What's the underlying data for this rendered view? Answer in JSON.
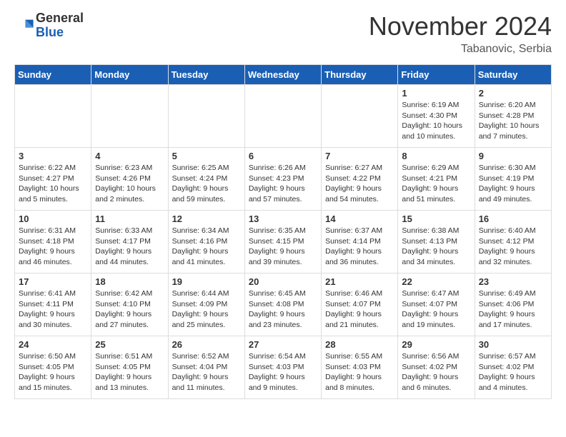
{
  "header": {
    "logo_general": "General",
    "logo_blue": "Blue",
    "month_title": "November 2024",
    "location": "Tabanovic, Serbia"
  },
  "weekdays": [
    "Sunday",
    "Monday",
    "Tuesday",
    "Wednesday",
    "Thursday",
    "Friday",
    "Saturday"
  ],
  "weeks": [
    [
      {
        "day": "",
        "info": ""
      },
      {
        "day": "",
        "info": ""
      },
      {
        "day": "",
        "info": ""
      },
      {
        "day": "",
        "info": ""
      },
      {
        "day": "",
        "info": ""
      },
      {
        "day": "1",
        "info": "Sunrise: 6:19 AM\nSunset: 4:30 PM\nDaylight: 10 hours and 10 minutes."
      },
      {
        "day": "2",
        "info": "Sunrise: 6:20 AM\nSunset: 4:28 PM\nDaylight: 10 hours and 7 minutes."
      }
    ],
    [
      {
        "day": "3",
        "info": "Sunrise: 6:22 AM\nSunset: 4:27 PM\nDaylight: 10 hours and 5 minutes."
      },
      {
        "day": "4",
        "info": "Sunrise: 6:23 AM\nSunset: 4:26 PM\nDaylight: 10 hours and 2 minutes."
      },
      {
        "day": "5",
        "info": "Sunrise: 6:25 AM\nSunset: 4:24 PM\nDaylight: 9 hours and 59 minutes."
      },
      {
        "day": "6",
        "info": "Sunrise: 6:26 AM\nSunset: 4:23 PM\nDaylight: 9 hours and 57 minutes."
      },
      {
        "day": "7",
        "info": "Sunrise: 6:27 AM\nSunset: 4:22 PM\nDaylight: 9 hours and 54 minutes."
      },
      {
        "day": "8",
        "info": "Sunrise: 6:29 AM\nSunset: 4:21 PM\nDaylight: 9 hours and 51 minutes."
      },
      {
        "day": "9",
        "info": "Sunrise: 6:30 AM\nSunset: 4:19 PM\nDaylight: 9 hours and 49 minutes."
      }
    ],
    [
      {
        "day": "10",
        "info": "Sunrise: 6:31 AM\nSunset: 4:18 PM\nDaylight: 9 hours and 46 minutes."
      },
      {
        "day": "11",
        "info": "Sunrise: 6:33 AM\nSunset: 4:17 PM\nDaylight: 9 hours and 44 minutes."
      },
      {
        "day": "12",
        "info": "Sunrise: 6:34 AM\nSunset: 4:16 PM\nDaylight: 9 hours and 41 minutes."
      },
      {
        "day": "13",
        "info": "Sunrise: 6:35 AM\nSunset: 4:15 PM\nDaylight: 9 hours and 39 minutes."
      },
      {
        "day": "14",
        "info": "Sunrise: 6:37 AM\nSunset: 4:14 PM\nDaylight: 9 hours and 36 minutes."
      },
      {
        "day": "15",
        "info": "Sunrise: 6:38 AM\nSunset: 4:13 PM\nDaylight: 9 hours and 34 minutes."
      },
      {
        "day": "16",
        "info": "Sunrise: 6:40 AM\nSunset: 4:12 PM\nDaylight: 9 hours and 32 minutes."
      }
    ],
    [
      {
        "day": "17",
        "info": "Sunrise: 6:41 AM\nSunset: 4:11 PM\nDaylight: 9 hours and 30 minutes."
      },
      {
        "day": "18",
        "info": "Sunrise: 6:42 AM\nSunset: 4:10 PM\nDaylight: 9 hours and 27 minutes."
      },
      {
        "day": "19",
        "info": "Sunrise: 6:44 AM\nSunset: 4:09 PM\nDaylight: 9 hours and 25 minutes."
      },
      {
        "day": "20",
        "info": "Sunrise: 6:45 AM\nSunset: 4:08 PM\nDaylight: 9 hours and 23 minutes."
      },
      {
        "day": "21",
        "info": "Sunrise: 6:46 AM\nSunset: 4:07 PM\nDaylight: 9 hours and 21 minutes."
      },
      {
        "day": "22",
        "info": "Sunrise: 6:47 AM\nSunset: 4:07 PM\nDaylight: 9 hours and 19 minutes."
      },
      {
        "day": "23",
        "info": "Sunrise: 6:49 AM\nSunset: 4:06 PM\nDaylight: 9 hours and 17 minutes."
      }
    ],
    [
      {
        "day": "24",
        "info": "Sunrise: 6:50 AM\nSunset: 4:05 PM\nDaylight: 9 hours and 15 minutes."
      },
      {
        "day": "25",
        "info": "Sunrise: 6:51 AM\nSunset: 4:05 PM\nDaylight: 9 hours and 13 minutes."
      },
      {
        "day": "26",
        "info": "Sunrise: 6:52 AM\nSunset: 4:04 PM\nDaylight: 9 hours and 11 minutes."
      },
      {
        "day": "27",
        "info": "Sunrise: 6:54 AM\nSunset: 4:03 PM\nDaylight: 9 hours and 9 minutes."
      },
      {
        "day": "28",
        "info": "Sunrise: 6:55 AM\nSunset: 4:03 PM\nDaylight: 9 hours and 8 minutes."
      },
      {
        "day": "29",
        "info": "Sunrise: 6:56 AM\nSunset: 4:02 PM\nDaylight: 9 hours and 6 minutes."
      },
      {
        "day": "30",
        "info": "Sunrise: 6:57 AM\nSunset: 4:02 PM\nDaylight: 9 hours and 4 minutes."
      }
    ]
  ]
}
